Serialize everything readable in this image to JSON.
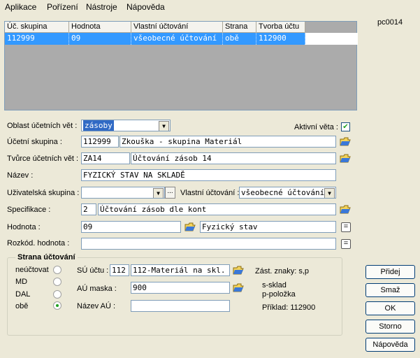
{
  "menu": [
    "Aplikace",
    "Pořízení",
    "Nástroje",
    "Nápověda"
  ],
  "screen_id": "pc0014",
  "grid": {
    "columns": [
      "Úč. skupina",
      "Hodnota",
      "Vlastní účtování",
      "Strana",
      "Tvorba účtu"
    ],
    "rows": [
      [
        "112999",
        "09",
        "všeobecné účtování",
        "obě",
        "112900"
      ]
    ]
  },
  "form": {
    "oblast_label": "Oblast účetních vět :",
    "oblast_value": "zásoby",
    "aktivni_label": "Aktivní věta :",
    "aktivni_checked": true,
    "ucetni_skupina_label": "Účetní skupina :",
    "ucetni_skupina_code": "112999",
    "ucetni_skupina_name": "Zkouška - skupina Materiál",
    "tvurce_label": "Tvůrce účetních vět :",
    "tvurce_code": "ZA14",
    "tvurce_name": "Účtování zásob 14",
    "nazev_label": "Název :",
    "nazev_value": "FYZICKÝ STAV NA SKLADĚ",
    "uzivatelska_label": "Uživatelská skupina :",
    "uzivatelska_value": "",
    "uzivatelska_btn": "...",
    "vlastni_label": "Vlastní účtování :",
    "vlastni_value": "všeobecné účtování",
    "specifikace_label": "Specifikace :",
    "specifikace_code": "2",
    "specifikace_name": "Účtování zásob dle kont",
    "hodnota_label": "Hodnota :",
    "hodnota_value": "09",
    "hodnota_name": "Fyzický stav",
    "rozkod_label": "Rozkód. hodnota :",
    "rozkod_value": "",
    "eq_symbol": "="
  },
  "strana": {
    "title": "Strana účtování",
    "options": [
      "neúčtovat",
      "MD",
      "DAL",
      "obě"
    ],
    "selected": "obě",
    "su_label": "SÚ účtu :",
    "su_code": "112",
    "su_name": "112-Materiál na skl.",
    "au_maska_label": "AÚ maska :",
    "au_maska_value": "900",
    "nazev_au_label": "Název AÚ :",
    "nazev_au_value": "",
    "zast_znaky": "Zást. znaky: s,p",
    "note1": "s-sklad",
    "note2": "p-položka",
    "priklad": "Příklad: 112900"
  },
  "buttons": {
    "pridej": "Přidej",
    "smaz": "Smaž",
    "ok": "OK",
    "storno": "Storno",
    "napoveda": "Nápověda"
  }
}
